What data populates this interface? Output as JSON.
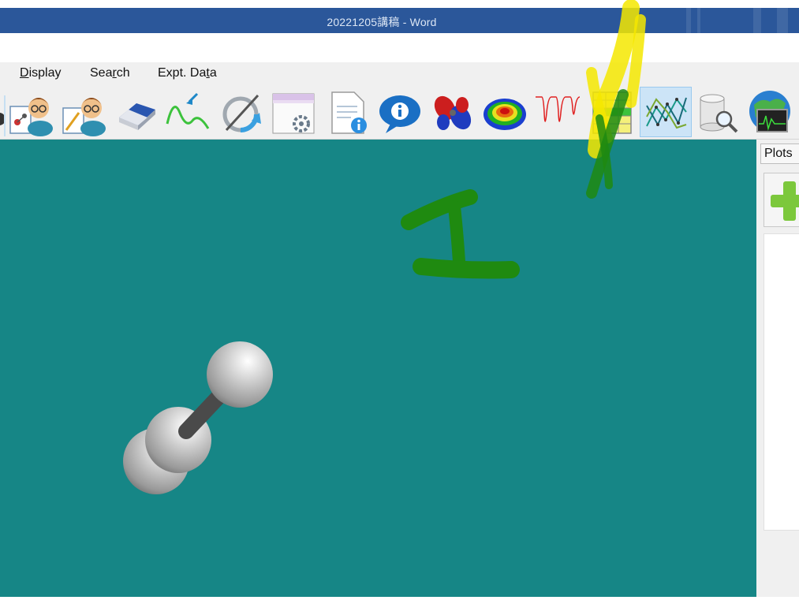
{
  "window": {
    "title": "20221205講稿  -  Word"
  },
  "menu": {
    "items": [
      {
        "label": "Display",
        "mnemonic": "D"
      },
      {
        "label": "Search",
        "mnemonic": "r"
      },
      {
        "label": "Expt. Data",
        "mnemonic": "t"
      }
    ]
  },
  "toolbar": {
    "tools": [
      {
        "icon": "molecule-user-icon"
      },
      {
        "icon": "edit-user-icon"
      },
      {
        "icon": "eraser-icon"
      },
      {
        "icon": "vibration-wave-icon"
      },
      {
        "icon": "refresh-slash-icon"
      },
      {
        "icon": "window-settings-icon"
      },
      {
        "icon": "document-info-icon"
      },
      {
        "icon": "info-bubble-icon"
      },
      {
        "icon": "orbital-icon"
      },
      {
        "icon": "surface-map-icon"
      },
      {
        "icon": "spectrum-icon"
      },
      {
        "icon": "spreadsheet-icon"
      },
      {
        "icon": "line-plot-icon",
        "active": true
      },
      {
        "icon": "database-search-icon"
      },
      {
        "icon": "globe-monitor-icon"
      }
    ]
  },
  "sidepanel": {
    "tab_label": "Plots",
    "add_icon": "plus-icon"
  },
  "colors": {
    "titlebar": "#2b579a",
    "viewport": "#168686",
    "annotation_green": "#1f8a10",
    "annotation_yellow": "#f5e800"
  }
}
